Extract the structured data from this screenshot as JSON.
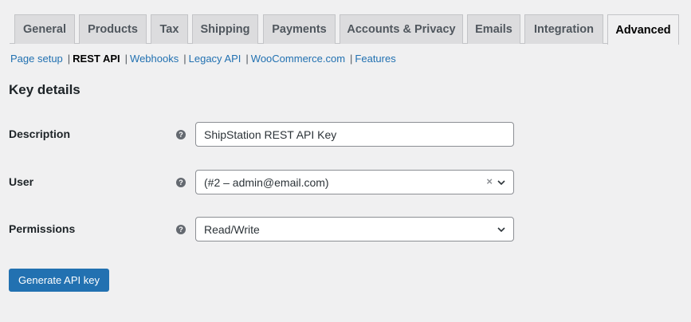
{
  "tabs": [
    "General",
    "Products",
    "Tax",
    "Shipping",
    "Payments",
    "Accounts & Privacy",
    "Emails",
    "Integration",
    "Advanced"
  ],
  "active_tab": "Advanced",
  "subnav": {
    "items": [
      "Page setup",
      "REST API",
      "Webhooks",
      "Legacy API",
      "WooCommerce.com",
      "Features"
    ],
    "current": "REST API",
    "separator": "|"
  },
  "section_title": "Key details",
  "help_glyph": "?",
  "fields": {
    "description": {
      "label": "Description",
      "value": "ShipStation REST API Key"
    },
    "user": {
      "label": "User",
      "value": "(#2 – admin@email.com)",
      "clear": "×"
    },
    "permissions": {
      "label": "Permissions",
      "value": "Read/Write"
    }
  },
  "generate_button": "Generate API key",
  "colors": {
    "accent": "#2271b1",
    "background": "#f0f0f1"
  }
}
